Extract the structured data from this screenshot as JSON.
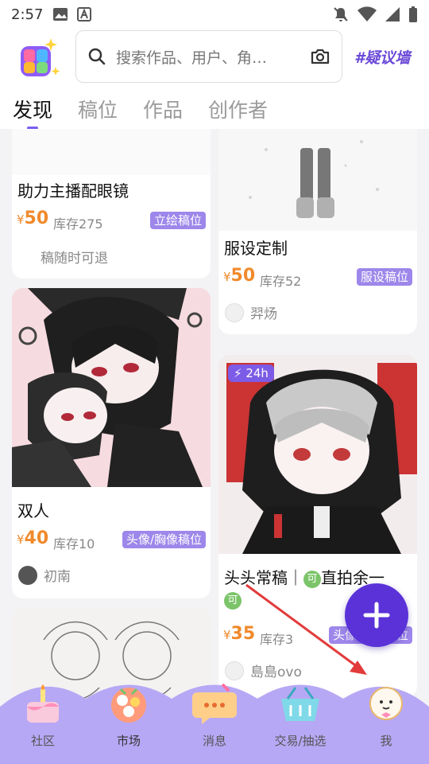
{
  "status_bar": {
    "time": "2:57"
  },
  "header": {
    "search_placeholder": "搜索作品、用户、角…",
    "tag_wall": "#疑议墙"
  },
  "tabs": [
    {
      "label": "发现",
      "active": true
    },
    {
      "label": "稿位"
    },
    {
      "label": "作品"
    },
    {
      "label": "创作者"
    }
  ],
  "cards": [
    {
      "title": "助力主播配眼镜",
      "price": "50",
      "stock": "库存275",
      "badge": "立绘稿位",
      "meta": "稿随时可退"
    },
    {
      "title": "服设定制",
      "price": "50",
      "stock": "库存52",
      "badge": "服设稿位",
      "author": "羿炀"
    },
    {
      "title": "双人",
      "price": "40",
      "stock": "库存10",
      "badge": "头像/胸像稿位",
      "author": "初南"
    },
    {
      "title": "头头常稿｜",
      "title_tail": "直拍余一",
      "title_icon": "可",
      "title_line2_icon": "可",
      "price": "35",
      "stock": "库存3",
      "badge": "头像/胸像稿位",
      "author": "島島ovo",
      "flash_badge": "24h"
    }
  ],
  "currency_symbol": "¥",
  "fab": {
    "label": "+"
  },
  "nav": [
    {
      "label": "社区"
    },
    {
      "label": "市场",
      "active": true
    },
    {
      "label": "消息"
    },
    {
      "label": "交易/抽选"
    },
    {
      "label": "我"
    }
  ],
  "colors": {
    "accent": "#7b5cf0",
    "price": "#f08a2c",
    "nav_bg": "#b7a8f5",
    "fab": "#5a32d8"
  }
}
